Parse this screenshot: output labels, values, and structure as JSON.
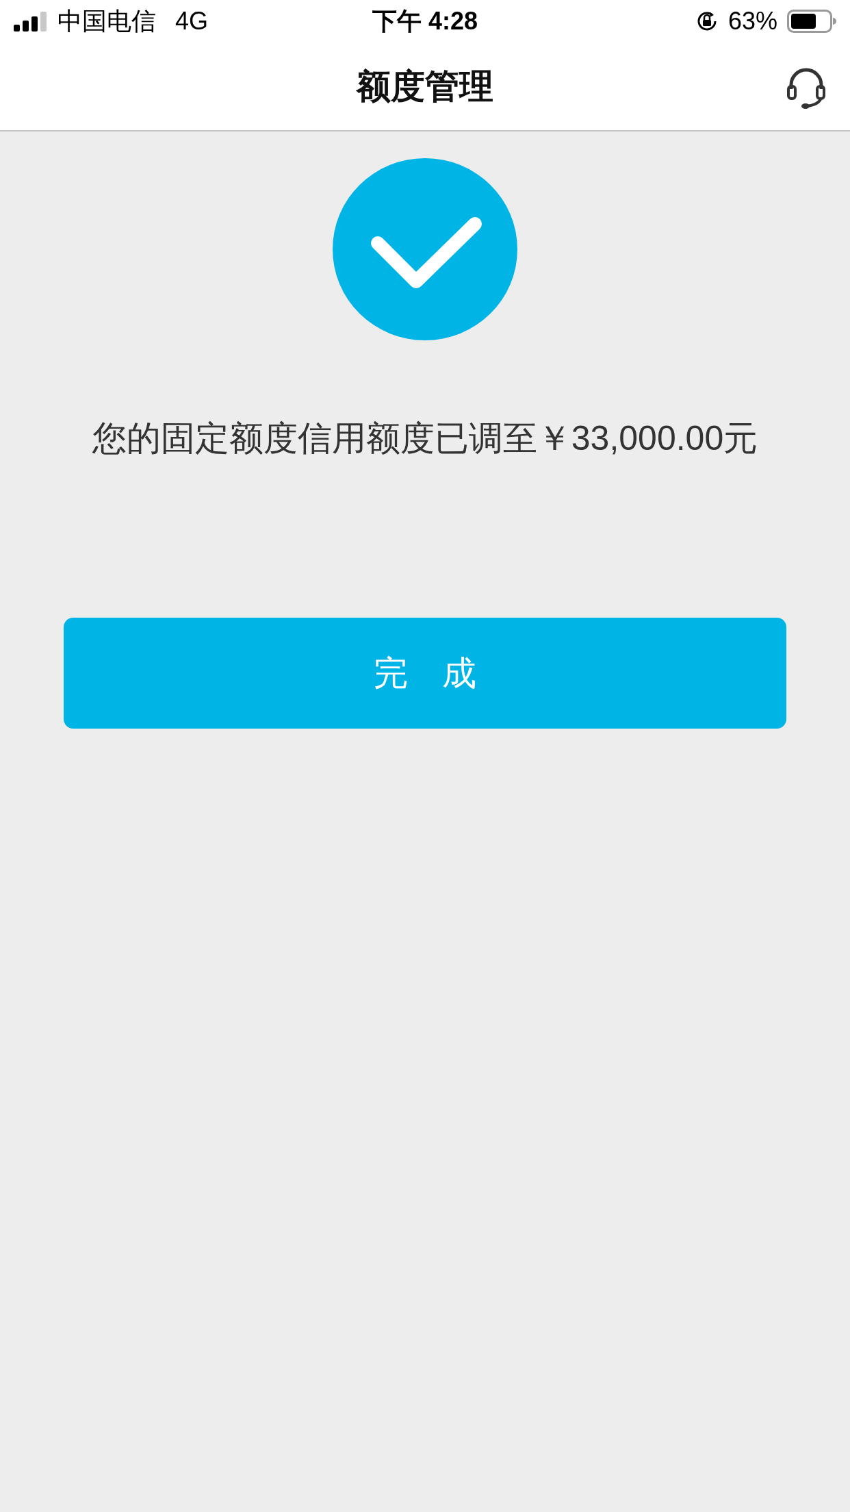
{
  "status_bar": {
    "carrier": "中国电信",
    "network": "4G",
    "time": "下午 4:28",
    "battery": "63%"
  },
  "header": {
    "title": "额度管理"
  },
  "result": {
    "message": "您的固定额度信用额度已调至￥33,000.00元"
  },
  "buttons": [
    {
      "label": "完　成"
    }
  ]
}
